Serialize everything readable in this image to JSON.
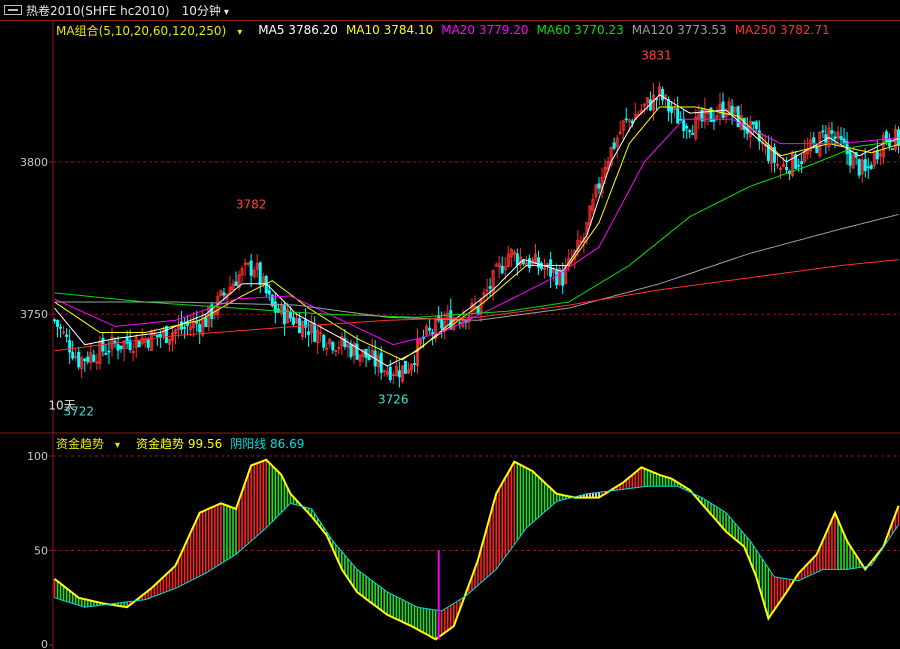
{
  "header": {
    "icon": "window-icon",
    "symbol": "热卷2010(SHFE hc2010)",
    "period": "10分钟"
  },
  "main_legend": {
    "group": "MA组合(5,10,20,60,120,250)",
    "items": [
      {
        "label": "MA5 3786.20",
        "color": "#ffffff"
      },
      {
        "label": "MA10 3784.10",
        "color": "#ffff00"
      },
      {
        "label": "MA20 3779.20",
        "color": "#ff00ff"
      },
      {
        "label": "MA60 3770.23",
        "color": "#00e000"
      },
      {
        "label": "MA120 3773.53",
        "color": "#a0a0a0"
      },
      {
        "label": "MA250 3782.71",
        "color": "#ff3030"
      }
    ]
  },
  "indicator_legend": {
    "group": "资金趋势",
    "items": [
      {
        "label": "资金趋势 99.56",
        "color": "#ffff00"
      },
      {
        "label": "阴阳线 86.69",
        "color": "#00e0e0"
      }
    ]
  },
  "chart_data": [
    {
      "type": "candlestick",
      "ylim": [
        3712,
        3840
      ],
      "yticks": [
        "3750",
        "3800"
      ],
      "yticks_values": [
        3750,
        3800
      ],
      "annotations": [
        {
          "text": "3782",
          "value": 3782,
          "bar": 65,
          "color": "#ff4040"
        },
        {
          "text": "3831",
          "value": 3831,
          "bar": 199,
          "color": "#ff4040"
        },
        {
          "text": "3726",
          "value": 3726,
          "bar": 112,
          "color": "#40e0e0"
        },
        {
          "text": "3722",
          "value": 3722,
          "bar": 8,
          "color": "#40e0e0"
        },
        {
          "text": "10天",
          "value": 3724,
          "bar": 2,
          "color": "#e0e0e0"
        }
      ],
      "colors": {
        "up": "#ff3030",
        "down": "#00ffff"
      },
      "close_path": [
        [
          0,
          3748
        ],
        [
          8,
          3735
        ],
        [
          20,
          3740
        ],
        [
          35,
          3743
        ],
        [
          50,
          3748
        ],
        [
          60,
          3762
        ],
        [
          66,
          3766
        ],
        [
          72,
          3752
        ],
        [
          80,
          3748
        ],
        [
          90,
          3742
        ],
        [
          100,
          3738
        ],
        [
          110,
          3732
        ],
        [
          116,
          3732
        ],
        [
          122,
          3742
        ],
        [
          130,
          3748
        ],
        [
          140,
          3752
        ],
        [
          150,
          3770
        ],
        [
          160,
          3766
        ],
        [
          168,
          3762
        ],
        [
          175,
          3775
        ],
        [
          182,
          3800
        ],
        [
          188,
          3812
        ],
        [
          195,
          3818
        ],
        [
          200,
          3822
        ],
        [
          205,
          3815
        ],
        [
          212,
          3812
        ],
        [
          222,
          3818
        ],
        [
          232,
          3808
        ],
        [
          240,
          3798
        ],
        [
          248,
          3802
        ],
        [
          256,
          3810
        ],
        [
          262,
          3803
        ],
        [
          268,
          3796
        ],
        [
          274,
          3808
        ],
        [
          280,
          3807
        ]
      ],
      "ma_series": [
        {
          "name": "MA5",
          "color": "#ffffff",
          "path": [
            [
              0,
              3752
            ],
            [
              10,
              3740
            ],
            [
              20,
              3742
            ],
            [
              35,
              3744
            ],
            [
              50,
              3750
            ],
            [
              62,
              3760
            ],
            [
              70,
              3760
            ],
            [
              80,
              3750
            ],
            [
              95,
              3742
            ],
            [
              110,
              3733
            ],
            [
              120,
              3738
            ],
            [
              132,
              3748
            ],
            [
              145,
              3758
            ],
            [
              155,
              3768
            ],
            [
              168,
              3764
            ],
            [
              176,
              3776
            ],
            [
              184,
              3800
            ],
            [
              192,
              3814
            ],
            [
              200,
              3822
            ],
            [
              210,
              3816
            ],
            [
              222,
              3817
            ],
            [
              232,
              3808
            ],
            [
              242,
              3800
            ],
            [
              256,
              3808
            ],
            [
              266,
              3802
            ],
            [
              274,
              3806
            ],
            [
              280,
              3808
            ]
          ]
        },
        {
          "name": "MA10",
          "color": "#ffff00",
          "path": [
            [
              0,
              3754
            ],
            [
              15,
              3744
            ],
            [
              30,
              3744
            ],
            [
              48,
              3748
            ],
            [
              62,
              3756
            ],
            [
              72,
              3761
            ],
            [
              84,
              3752
            ],
            [
              100,
              3742
            ],
            [
              115,
              3735
            ],
            [
              128,
              3744
            ],
            [
              142,
              3754
            ],
            [
              156,
              3766
            ],
            [
              170,
              3766
            ],
            [
              180,
              3780
            ],
            [
              190,
              3806
            ],
            [
              200,
              3818
            ],
            [
              212,
              3818
            ],
            [
              226,
              3815
            ],
            [
              240,
              3802
            ],
            [
              256,
              3806
            ],
            [
              270,
              3803
            ],
            [
              280,
              3806
            ]
          ]
        },
        {
          "name": "MA20",
          "color": "#ff00ff",
          "path": [
            [
              0,
              3755
            ],
            [
              20,
              3746
            ],
            [
              40,
              3748
            ],
            [
              60,
              3755
            ],
            [
              78,
              3756
            ],
            [
              95,
              3748
            ],
            [
              112,
              3740
            ],
            [
              128,
              3744
            ],
            [
              145,
              3752
            ],
            [
              165,
              3762
            ],
            [
              180,
              3772
            ],
            [
              195,
              3800
            ],
            [
              208,
              3814
            ],
            [
              224,
              3814
            ],
            [
              240,
              3806
            ],
            [
              260,
              3806
            ],
            [
              280,
              3808
            ]
          ]
        },
        {
          "name": "MA60",
          "color": "#00e000",
          "path": [
            [
              0,
              3757
            ],
            [
              30,
              3754
            ],
            [
              60,
              3752
            ],
            [
              90,
              3750
            ],
            [
              120,
              3749
            ],
            [
              150,
              3751
            ],
            [
              170,
              3754
            ],
            [
              190,
              3766
            ],
            [
              210,
              3782
            ],
            [
              230,
              3792
            ],
            [
              250,
              3799
            ],
            [
              265,
              3805
            ],
            [
              280,
              3807
            ]
          ]
        },
        {
          "name": "MA120",
          "color": "#a0a0a0",
          "path": [
            [
              0,
              3754
            ],
            [
              40,
              3754
            ],
            [
              80,
              3753
            ],
            [
              110,
              3749
            ],
            [
              140,
              3748
            ],
            [
              170,
              3752
            ],
            [
              200,
              3760
            ],
            [
              230,
              3770
            ],
            [
              260,
              3778
            ],
            [
              280,
              3783
            ]
          ]
        },
        {
          "name": "MA250",
          "color": "#ff3030",
          "path": [
            [
              0,
              3738
            ],
            [
              40,
              3743
            ],
            [
              80,
              3746
            ],
            [
              110,
              3748
            ],
            [
              140,
              3749
            ],
            [
              170,
              3753
            ],
            [
              200,
              3758
            ],
            [
              230,
              3762
            ],
            [
              260,
              3766
            ],
            [
              280,
              3768
            ]
          ]
        }
      ]
    },
    {
      "type": "histogram",
      "ylim": [
        0,
        100
      ],
      "yticks": [
        "0",
        "50",
        "100"
      ],
      "yticks_values": [
        0,
        50,
        100
      ],
      "series": [
        {
          "name": "资金趋势",
          "color": "#ffff00",
          "path": [
            [
              0,
              35
            ],
            [
              8,
              25
            ],
            [
              16,
              22
            ],
            [
              24,
              20
            ],
            [
              32,
              30
            ],
            [
              40,
              42
            ],
            [
              48,
              70
            ],
            [
              55,
              75
            ],
            [
              60,
              72
            ],
            [
              65,
              95
            ],
            [
              70,
              98
            ],
            [
              75,
              90
            ],
            [
              78,
              80
            ],
            [
              85,
              68
            ],
            [
              90,
              58
            ],
            [
              95,
              40
            ],
            [
              100,
              28
            ],
            [
              110,
              16
            ],
            [
              118,
              10
            ],
            [
              126,
              3
            ],
            [
              132,
              10
            ],
            [
              140,
              45
            ],
            [
              146,
              80
            ],
            [
              152,
              97
            ],
            [
              158,
              92
            ],
            [
              166,
              80
            ],
            [
              172,
              78
            ],
            [
              180,
              78
            ],
            [
              188,
              86
            ],
            [
              194,
              94
            ],
            [
              200,
              90
            ],
            [
              204,
              88
            ],
            [
              210,
              82
            ],
            [
              222,
              60
            ],
            [
              228,
              52
            ],
            [
              232,
              36
            ],
            [
              236,
              14
            ],
            [
              242,
              28
            ],
            [
              246,
              38
            ],
            [
              252,
              48
            ],
            [
              258,
              70
            ],
            [
              262,
              55
            ],
            [
              268,
              40
            ],
            [
              274,
              52
            ],
            [
              280,
              78
            ]
          ]
        },
        {
          "name": "阴阳线",
          "color": "#00e0e0",
          "path": [
            [
              0,
              25
            ],
            [
              10,
              20
            ],
            [
              20,
              22
            ],
            [
              30,
              24
            ],
            [
              40,
              30
            ],
            [
              50,
              38
            ],
            [
              60,
              48
            ],
            [
              70,
              62
            ],
            [
              78,
              75
            ],
            [
              85,
              72
            ],
            [
              92,
              55
            ],
            [
              100,
              40
            ],
            [
              110,
              28
            ],
            [
              120,
              20
            ],
            [
              128,
              18
            ],
            [
              136,
              26
            ],
            [
              146,
              40
            ],
            [
              156,
              62
            ],
            [
              166,
              76
            ],
            [
              176,
              80
            ],
            [
              186,
              82
            ],
            [
              196,
              84
            ],
            [
              206,
              84
            ],
            [
              214,
              78
            ],
            [
              222,
              70
            ],
            [
              230,
              55
            ],
            [
              238,
              36
            ],
            [
              246,
              34
            ],
            [
              254,
              40
            ],
            [
              262,
              40
            ],
            [
              270,
              42
            ],
            [
              280,
              66
            ]
          ]
        }
      ],
      "bar_colors": {
        "rising": "#ff2020",
        "falling": "#20e020",
        "neutral": "#ffffff"
      }
    }
  ]
}
